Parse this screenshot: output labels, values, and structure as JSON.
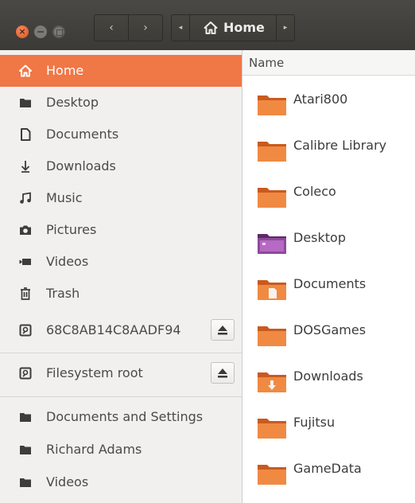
{
  "window": {
    "close_glyph": "×",
    "back_glyph": "‹",
    "forward_glyph": "›",
    "path_left_glyph": "◂",
    "path_right_glyph": "▸"
  },
  "path_bar": {
    "current": "Home"
  },
  "colors": {
    "accent": "#f07746",
    "titlebar": "#3b3a36",
    "folder": "#ef7d37"
  },
  "sidebar": {
    "items": [
      {
        "label": "Home",
        "icon": "home-icon",
        "active": true
      },
      {
        "label": "Desktop",
        "icon": "folder-icon"
      },
      {
        "label": "Documents",
        "icon": "document-icon"
      },
      {
        "label": "Downloads",
        "icon": "download-icon"
      },
      {
        "label": "Music",
        "icon": "music-icon"
      },
      {
        "label": "Pictures",
        "icon": "camera-icon"
      },
      {
        "label": "Videos",
        "icon": "video-icon"
      },
      {
        "label": "Trash",
        "icon": "trash-icon"
      },
      {
        "label": "68C8AB14C8AADF94",
        "icon": "drive-icon",
        "eject": true
      }
    ],
    "devices": [
      {
        "label": "Filesystem root",
        "icon": "drive-icon",
        "eject": true
      }
    ],
    "bookmarks": [
      {
        "label": "Documents and Settings",
        "icon": "folder-icon"
      },
      {
        "label": "Richard Adams",
        "icon": "folder-icon"
      },
      {
        "label": "Videos",
        "icon": "folder-icon"
      }
    ]
  },
  "main": {
    "column_header": "Name",
    "files": [
      {
        "name": "Atari800",
        "type": "folder"
      },
      {
        "name": "Calibre Library",
        "type": "folder"
      },
      {
        "name": "Coleco",
        "type": "folder"
      },
      {
        "name": "Desktop",
        "type": "desktop-folder"
      },
      {
        "name": "Documents",
        "type": "documents-folder"
      },
      {
        "name": "DOSGames",
        "type": "folder"
      },
      {
        "name": "Downloads",
        "type": "downloads-folder"
      },
      {
        "name": "Fujitsu",
        "type": "folder"
      },
      {
        "name": "GameData",
        "type": "folder"
      }
    ]
  }
}
